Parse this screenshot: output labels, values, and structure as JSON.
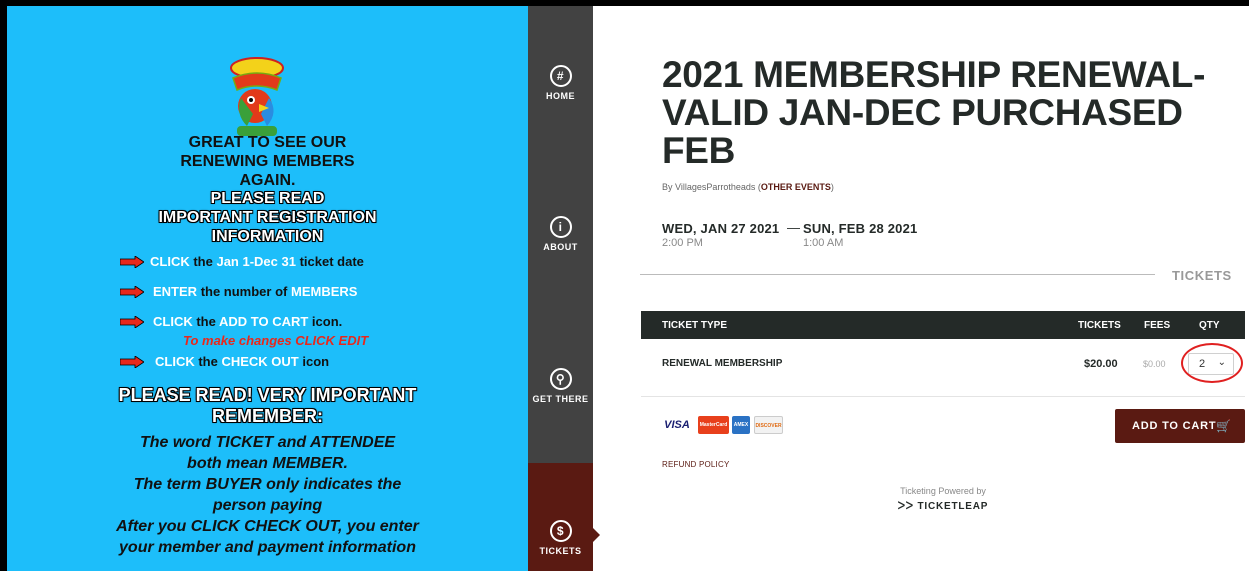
{
  "promo": {
    "greeting": [
      "GREAT TO SEE OUR",
      "RENEWING MEMBERS",
      "AGAIN."
    ],
    "read_lines": [
      "PLEASE READ",
      "IMPORTANT REGISTRATION",
      "INFORMATION"
    ],
    "steps": [
      {
        "verb": "CLICK",
        "t1": "the",
        "hl": "Jan 1-Dec 31",
        "t2": "ticket date"
      },
      {
        "verb": "ENTER",
        "t1": "the number of",
        "hl": "MEMBERS",
        "t2": ""
      },
      {
        "verb": "CLICK",
        "t1": "the",
        "hl": "ADD TO CART",
        "t2": "icon."
      },
      {
        "verb": "CLICK",
        "t1": "the",
        "hl": "CHECK OUT",
        "t2": "icon"
      }
    ],
    "changes_note": "To make changes CLICK EDIT",
    "important": [
      "PLEASE READ! VERY IMPORTANT",
      "REMEMBER:"
    ],
    "italic_lines": [
      "The word TICKET and ATTENDEE",
      "both mean MEMBER.",
      "The term BUYER only indicates the",
      "person paying",
      "After you CLICK CHECK OUT, you enter",
      "your member and payment information"
    ],
    "colors": {
      "background": "#1dbefa",
      "arrow": "#e8281c"
    }
  },
  "nav": {
    "home": {
      "label": "HOME",
      "glyph": "#"
    },
    "about": {
      "label": "ABOUT",
      "glyph": "i"
    },
    "get_there": {
      "label": "GET THERE",
      "glyph": "⚲"
    },
    "tickets": {
      "label": "TICKETS",
      "glyph": "$"
    },
    "active": "tickets"
  },
  "event": {
    "title_lines": [
      "2021 MEMBERSHIP RENEWAL-",
      "VALID JAN-DEC PURCHASED",
      "FEB"
    ],
    "by_prefix": "By VillagesParrotheads (",
    "other_events": "OTHER EVENTS",
    "by_suffix": ")",
    "start_date": "WED, JAN 27 2021",
    "start_time": "2:00 PM",
    "dash": "—",
    "end_date": "SUN, FEB 28 2021",
    "end_time": "1:00 AM"
  },
  "tickets": {
    "section_label": "TICKETS",
    "columns": {
      "type": "TICKET TYPE",
      "tickets": "TICKETS",
      "fees": "FEES",
      "qty": "QTY"
    },
    "rows": [
      {
        "type": "RENEWAL MEMBERSHIP",
        "price": "$20.00",
        "fee": "$0.00",
        "qty": "2"
      }
    ],
    "payment_cards": [
      "VISA",
      "MasterCard",
      "AMEX",
      "DISCOVER"
    ],
    "add_to_cart": "ADD TO CART",
    "refund_policy": "REFUND POLICY",
    "powered_by": "Ticketing Powered by",
    "brand": "TICKETLEAP",
    "colors": {
      "accent": "#5a1a12",
      "header": "#242a28",
      "highlight_ring": "#e02020"
    }
  }
}
